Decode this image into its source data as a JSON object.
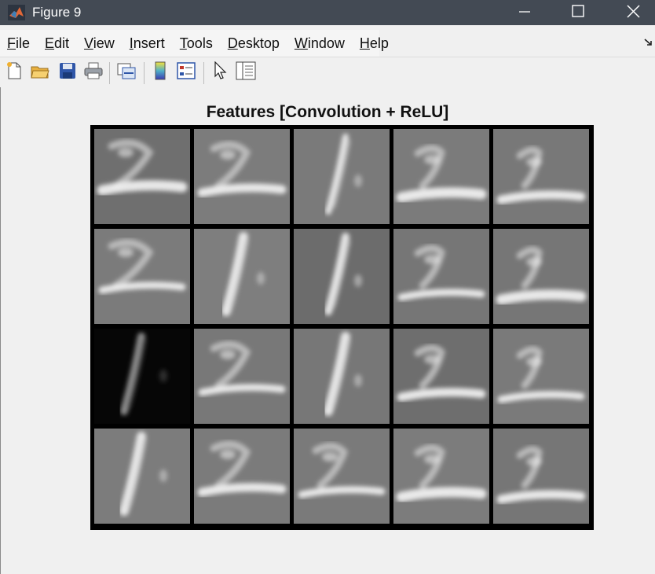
{
  "window": {
    "title": "Figure 9",
    "controls": [
      "minimize-icon",
      "maximize-icon",
      "close-icon"
    ]
  },
  "menubar": {
    "items": [
      {
        "label": "File",
        "mnemonic": "F",
        "rest": "ile"
      },
      {
        "label": "Edit",
        "mnemonic": "E",
        "rest": "dit"
      },
      {
        "label": "View",
        "mnemonic": "V",
        "rest": "iew"
      },
      {
        "label": "Insert",
        "mnemonic": "I",
        "rest": "nsert"
      },
      {
        "label": "Tools",
        "mnemonic": "T",
        "rest": "ools"
      },
      {
        "label": "Desktop",
        "mnemonic": "D",
        "rest": "esktop"
      },
      {
        "label": "Window",
        "mnemonic": "W",
        "rest": "indow"
      },
      {
        "label": "Help",
        "mnemonic": "H",
        "rest": "elp"
      }
    ]
  },
  "toolbar": {
    "icons": [
      "new-figure-icon",
      "open-file-icon",
      "save-icon",
      "print-icon",
      "link-plot-icon",
      "colorbar-icon",
      "legend-icon",
      "pointer-icon",
      "property-inspector-icon"
    ]
  },
  "figure": {
    "title": "Features [Convolution + ReLU]",
    "grid": {
      "rows": 4,
      "cols": 5
    },
    "tiles": [
      {
        "bg": "#6f6f6f",
        "digit": "2"
      },
      {
        "bg": "#7c7c7c",
        "digit": "2"
      },
      {
        "bg": "#7a7a7a",
        "digit": "1"
      },
      {
        "bg": "#7b7b7b",
        "digit": "2"
      },
      {
        "bg": "#787878",
        "digit": "2"
      },
      {
        "bg": "#7b7b7b",
        "digit": "2"
      },
      {
        "bg": "#7e7e7e",
        "digit": "1"
      },
      {
        "bg": "#6c6c6c",
        "digit": "1"
      },
      {
        "bg": "#767676",
        "digit": "2"
      },
      {
        "bg": "#767676",
        "digit": "2"
      },
      {
        "bg": "#060606",
        "digit": "1"
      },
      {
        "bg": "#787878",
        "digit": "2"
      },
      {
        "bg": "#777777",
        "digit": "1"
      },
      {
        "bg": "#6e6e6e",
        "digit": "2"
      },
      {
        "bg": "#7a7a7a",
        "digit": "2"
      },
      {
        "bg": "#7c7c7c",
        "digit": "1"
      },
      {
        "bg": "#7b7b7b",
        "digit": "2"
      },
      {
        "bg": "#7a7a7a",
        "digit": "2"
      },
      {
        "bg": "#7c7c7c",
        "digit": "2"
      },
      {
        "bg": "#767676",
        "digit": "2"
      }
    ]
  }
}
